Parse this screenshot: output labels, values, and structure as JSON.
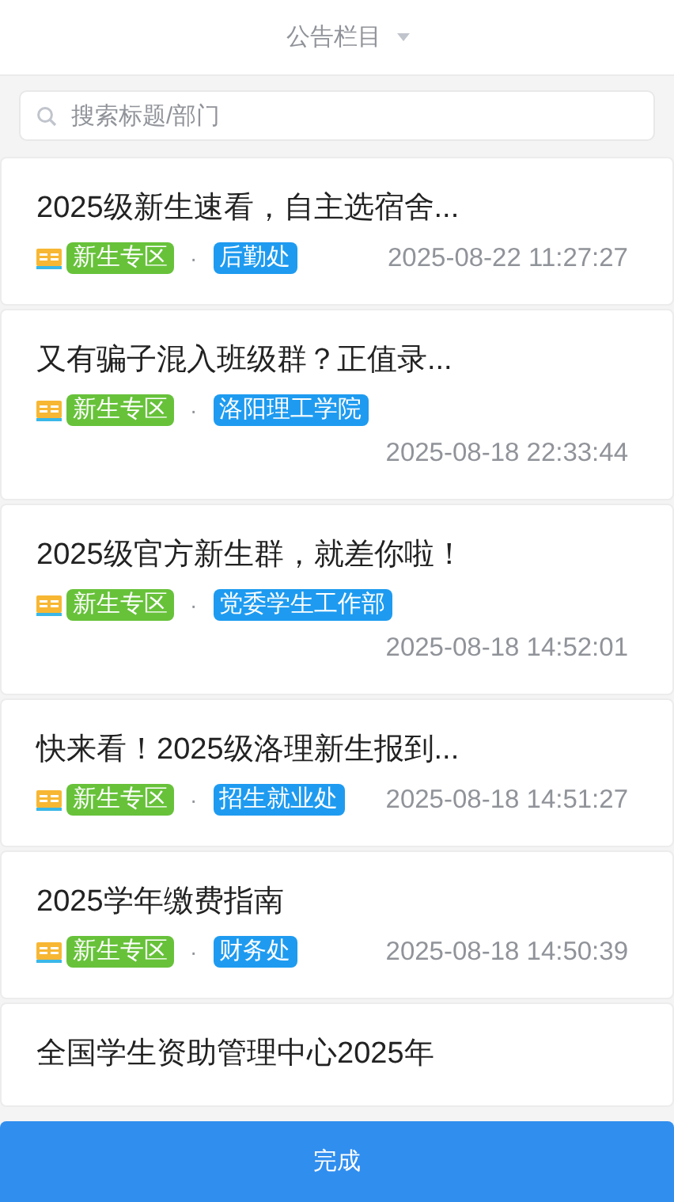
{
  "header": {
    "title": "公告栏目"
  },
  "search": {
    "placeholder": "搜索标题/部门"
  },
  "notices": [
    {
      "title": "2025级新生速看，自主选宿舍...",
      "category": "新生专区",
      "separator": "·",
      "department": "后勤处",
      "time": "2025-08-22 11:27:27"
    },
    {
      "title": "又有骗子混入班级群？正值录...",
      "category": "新生专区",
      "separator": "·",
      "department": "洛阳理工学院",
      "time": "2025-08-18 22:33:44"
    },
    {
      "title": "2025级官方新生群，就差你啦！",
      "category": "新生专区",
      "separator": "·",
      "department": "党委学生工作部",
      "time": "2025-08-18 14:52:01"
    },
    {
      "title": "快来看！2025级洛理新生报到...",
      "category": "新生专区",
      "separator": "·",
      "department": "招生就业处",
      "time": "2025-08-18 14:51:27"
    },
    {
      "title": "2025学年缴费指南",
      "category": "新生专区",
      "separator": "·",
      "department": "财务处",
      "time": "2025-08-18 14:50:39"
    },
    {
      "title": "全国学生资助管理中心2025年"
    }
  ],
  "done_button": {
    "label": "完成"
  }
}
